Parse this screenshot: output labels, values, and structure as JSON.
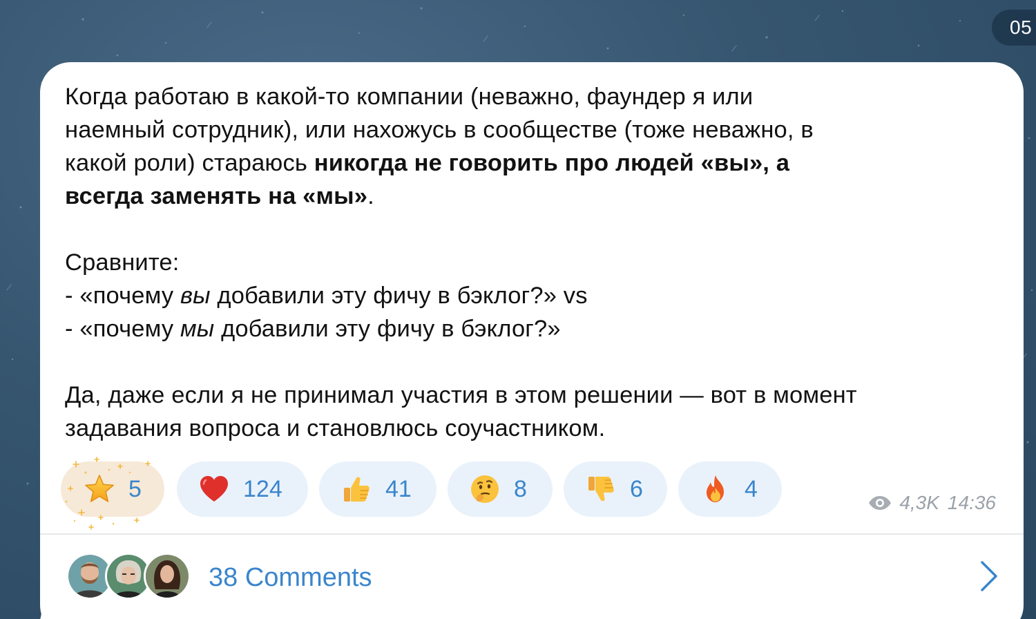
{
  "date_pill": "05",
  "message": {
    "line1": "Когда работаю в какой-то компании (неважно, фаундер я или",
    "line2": "наемный сотрудник), или нахожусь в сообществе (тоже неважно, в",
    "line3_plain": "какой роли) стараюсь ",
    "line3_bold": "никогда не говорить про людей «вы», а",
    "line4_bold": "всегда заменять на «мы»",
    "line4_end": ".",
    "compare_label": "Сравните:",
    "ex1_start": "- «почему ",
    "ex1_italic": "вы",
    "ex1_end": " добавили эту фичу в бэклог?» vs",
    "ex2_start": "- «почему ",
    "ex2_italic": "мы",
    "ex2_end": " добавили эту фичу в бэклог?»",
    "para3_line1": "Да, даже если я не принимал участия в этом решении — вот в момент",
    "para3_line2": "задавания вопроса и становлюсь соучастником."
  },
  "reactions": [
    {
      "icon": "star-icon",
      "count": "5"
    },
    {
      "icon": "heart-icon",
      "count": "124"
    },
    {
      "icon": "thumbs-up-icon",
      "count": "41"
    },
    {
      "icon": "thinking-face-icon",
      "count": "8"
    },
    {
      "icon": "thumbs-down-icon",
      "count": "6"
    },
    {
      "icon": "fire-icon",
      "count": "4"
    }
  ],
  "meta": {
    "views": "4,3K",
    "time": "14:36"
  },
  "comments": {
    "label": "38 Comments"
  },
  "colors": {
    "accent": "#3a85cb",
    "reaction_bg": "#e9f2fb",
    "star_reaction_bg": "#f6e9d7",
    "meta_text": "#9aa1a8",
    "background": "#36556f"
  }
}
